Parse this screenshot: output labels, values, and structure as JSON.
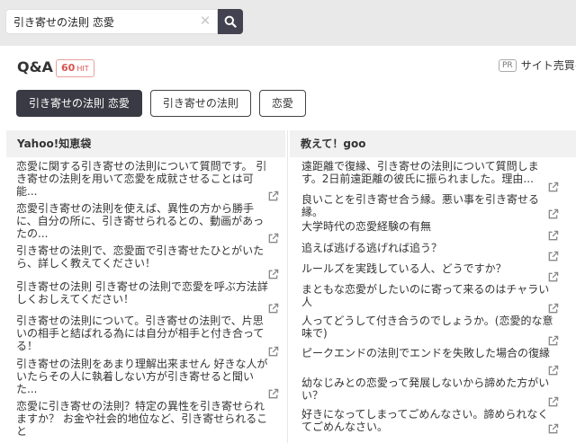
{
  "search": {
    "value": "引き寄せの法則 恋愛",
    "clear_icon": "close-icon",
    "button_icon": "search-icon"
  },
  "header": {
    "title": "Q&A",
    "hit_count": "60",
    "hit_unit": "HIT",
    "pr_badge": "PR",
    "pr_text": "サイト売買の"
  },
  "tags": [
    {
      "label": "引き寄せの法則 恋愛",
      "active": true
    },
    {
      "label": "引き寄せの法則",
      "active": false
    },
    {
      "label": "恋愛",
      "active": false
    }
  ],
  "columns": [
    {
      "source": "Yahoo!知恵袋",
      "items": [
        "恋愛に関する引き寄せの法則について質問です。 引き寄せの法則を用いて恋愛を成就させることは可能...",
        "恋愛引き寄せの法則を使えば、異性の方から勝手に、自分の所に、引き寄せられるとの、動画があったの...",
        "引き寄せの法則で、恋愛面で引き寄せたひとがいたら、詳しく教えてください！",
        "引き寄せの法則 引き寄せの法則で恋愛を呼ぶ方法詳しくおしえてください！",
        "引き寄せの法則について。引き寄せの法則で、片思いの相手と結ばれる為には自分が相手と付き合ってる！",
        "引き寄せの法則をあまり理解出来ません 好きな人がいたらその人に執着しない方が引き寄せると聞いた...",
        "恋愛に引き寄せの法則？特定の異性を引き寄せられますか？ お金や社会的地位など、引き寄せられること"
      ]
    },
    {
      "source": "教えて！goo",
      "items": [
        "遠距離で復縁、引き寄せの法則について質問します。2日前遠距離の彼氏に振られました。理由...",
        "良いことを引き寄せ合う縁。悪い事を引き寄せる縁。",
        "大学時代の恋愛経験の有無",
        "追えば逃げる逃げれば追う？",
        "ルールズを実践している人、どうですか？",
        "まともな恋愛がしたいのに寄って来るのはチャラい人",
        "人ってどうして付き合うのでしょうか。(恋愛的な意味で)",
        "ピークエンドの法則でエンドを失敗した場合の復縁",
        "幼なじみとの恋愛って発展しないから諦めた方がいい？",
        "好きになってしまってごめんなさい。諦められなくてごめんなさい。"
      ]
    }
  ],
  "item_icon": "external-link-icon",
  "colors": {
    "accent": "#3a3a44",
    "hit_badge": "#d9534f",
    "background": "#e9e9e9"
  }
}
